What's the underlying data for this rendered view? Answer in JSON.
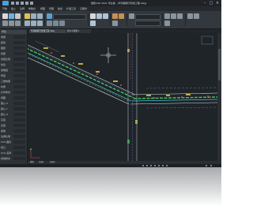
{
  "window": {
    "title": "浩辰CAD 2021 专业版 - [华清路雨污管线工程.dwg]"
  },
  "menubar": {
    "items": [
      "开始",
      "插入",
      "注释",
      "参数化",
      "视图",
      "管理",
      "输出",
      "扩展工具",
      "云服务"
    ]
  },
  "document_tabs": [
    {
      "label": "华清路雨污管线工程.dwg"
    },
    {
      "label": "排水平面图-1"
    }
  ],
  "palette": {
    "title": "特性",
    "rows": [
      "常规",
      "颜色",
      "图层",
      "线型",
      "线型比例",
      "线宽",
      "透明度",
      "厚度",
      "三维效果",
      "材质",
      "打印样式",
      "视图",
      "圆心 X",
      "圆心 Y",
      "圆心 Z",
      "高度",
      "宽度",
      "其他",
      "注释比例",
      "UCS 图标",
      "视口",
      "UCS 名称",
      "视觉样式"
    ]
  },
  "layout_tabs": [
    "模型",
    "布局1",
    "布局2"
  ],
  "colors": {
    "canvas_bg": "#1f2428",
    "road_edge": "#d8dde2",
    "pipe_green": "#48c864",
    "pipe_cyan": "#3ac8d8",
    "annot_yellow": "#e0d050",
    "annot_red": "#d05050"
  }
}
